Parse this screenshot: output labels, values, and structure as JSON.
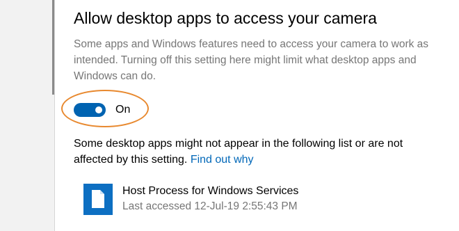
{
  "section": {
    "title": "Allow desktop apps to access your camera",
    "description": "Some apps and Windows features need to access your camera to work as intended. Turning off this setting here might limit what desktop apps and Windows can do.",
    "toggle": {
      "state": true,
      "label": "On"
    },
    "note": "Some desktop apps might not appear in the following list or are not affected by this setting.",
    "find_out_link": "Find out why"
  },
  "apps": [
    {
      "name": "Host Process for Windows Services",
      "last_accessed": "Last accessed 12-Jul-19 2:55:43 PM",
      "icon": "document-icon"
    }
  ],
  "colors": {
    "accent": "#0063b1",
    "link": "#0067b8",
    "annotation": "#e8892f",
    "secondary_text": "#767676"
  }
}
